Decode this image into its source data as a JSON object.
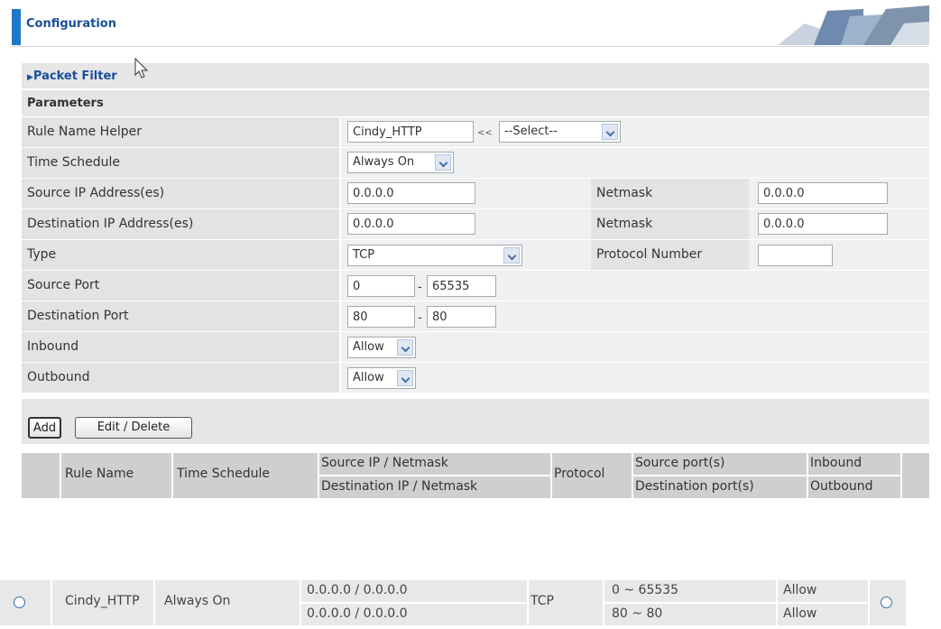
{
  "header": {
    "title": "Configuration"
  },
  "section": {
    "label": "Packet Filter"
  },
  "params": {
    "title": "Parameters",
    "rule_name_label": "Rule Name  Helper",
    "rule_name_value": "Cindy_HTTP",
    "helper_arrows": "<<",
    "helper_select": "--Select--",
    "time_schedule_label": "Time Schedule",
    "time_schedule_value": "Always On",
    "source_ip_label": "Source IP Address(es)",
    "source_ip_value": "0.0.0.0",
    "source_netmask_label": "Netmask",
    "source_netmask_value": "0.0.0.0",
    "dest_ip_label": "Destination IP Address(es)",
    "dest_ip_value": "0.0.0.0",
    "dest_netmask_label": "Netmask",
    "dest_netmask_value": "0.0.0.0",
    "type_label": "Type",
    "type_value": "TCP",
    "protocol_number_label": "Protocol Number",
    "protocol_number_value": "",
    "source_port_label": "Source Port",
    "source_port_from": "0",
    "source_port_to": "65535",
    "dest_port_label": "Destination Port",
    "dest_port_from": "80",
    "dest_port_to": "80",
    "port_dash": "-",
    "inbound_label": "Inbound",
    "inbound_value": "Allow",
    "outbound_label": "Outbound",
    "outbound_value": "Allow"
  },
  "buttons": {
    "add": "Add",
    "edit_delete": "Edit / Delete"
  },
  "list_header": {
    "rule_name": "Rule Name",
    "time_schedule": "Time Schedule",
    "source_ip_netmask": "Source IP / Netmask",
    "dest_ip_netmask": "Destination IP / Netmask",
    "protocol": "Protocol",
    "source_ports": "Source port(s)",
    "dest_ports": "Destination port(s)",
    "inbound": "Inbound",
    "outbound": "Outbound"
  },
  "list_rows": [
    {
      "rule_name": "Cindy_HTTP",
      "time_schedule": "Always On",
      "source_ip": "0.0.0.0 / 0.0.0.0",
      "dest_ip": "0.0.0.0 / 0.0.0.0",
      "protocol": "TCP",
      "source_ports": "0 ~ 65535",
      "dest_ports": "80 ~ 80",
      "inbound": "Allow",
      "outbound": "Allow"
    }
  ]
}
